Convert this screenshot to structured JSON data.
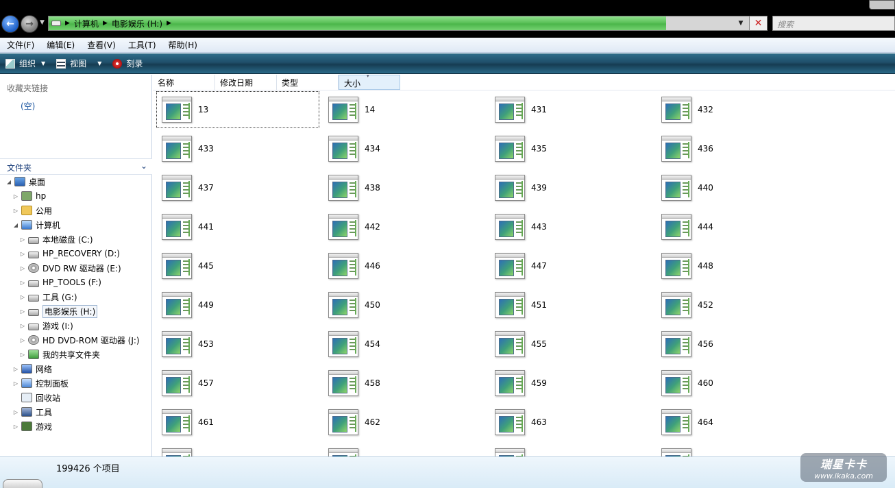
{
  "address_bar": {
    "crumbs": [
      "计算机",
      "电影娱乐 (H:)"
    ],
    "progress": 0.86
  },
  "search": {
    "placeholder": "搜索"
  },
  "menu": [
    "文件(F)",
    "编辑(E)",
    "查看(V)",
    "工具(T)",
    "帮助(H)"
  ],
  "toolbar": {
    "organize": "组织",
    "views": "视图",
    "burn": "刻录"
  },
  "nav": {
    "favorites_title": "收藏夹链接",
    "favorites_empty": "(空)",
    "folders_title": "文件夹"
  },
  "tree": [
    {
      "label": "桌面",
      "icon": "desktop-icon"
    },
    {
      "label": "hp",
      "icon": "user-icon"
    },
    {
      "label": "公用",
      "icon": "folder-icon"
    },
    {
      "label": "计算机",
      "icon": "computer-icon"
    },
    {
      "label": "本地磁盘 (C:)",
      "icon": "hdd-icon"
    },
    {
      "label": "HP_RECOVERY (D:)",
      "icon": "hdd-icon"
    },
    {
      "label": "DVD RW 驱动器 (E:)",
      "icon": "dvd-icon"
    },
    {
      "label": "HP_TOOLS (F:)",
      "icon": "hdd-icon"
    },
    {
      "label": "工具 (G:)",
      "icon": "hdd-icon"
    },
    {
      "label": "电影娱乐 (H:)",
      "icon": "hdd-icon"
    },
    {
      "label": "游戏 (I:)",
      "icon": "hdd-icon"
    },
    {
      "label": "HD DVD-ROM 驱动器 (J:)",
      "icon": "dvd-icon"
    },
    {
      "label": "我的共享文件夹",
      "icon": "share-icon"
    },
    {
      "label": "网络",
      "icon": "network-icon"
    },
    {
      "label": "控制面板",
      "icon": "control-panel-icon"
    },
    {
      "label": "回收站",
      "icon": "recycle-bin-icon"
    },
    {
      "label": "工具",
      "icon": "tools-icon"
    },
    {
      "label": "游戏",
      "icon": "games-icon"
    }
  ],
  "columns": [
    "名称",
    "修改日期",
    "类型",
    "大小"
  ],
  "files": [
    "13",
    "14",
    "431",
    "432",
    "433",
    "434",
    "435",
    "436",
    "437",
    "438",
    "439",
    "440",
    "441",
    "442",
    "443",
    "444",
    "445",
    "446",
    "447",
    "448",
    "449",
    "450",
    "451",
    "452",
    "453",
    "454",
    "455",
    "456",
    "457",
    "458",
    "459",
    "460",
    "461",
    "462",
    "463",
    "464"
  ],
  "status": {
    "count": "199426 个项目"
  },
  "watermark": {
    "main": "瑞星卡卡",
    "sub": "www.ikaka.com"
  }
}
